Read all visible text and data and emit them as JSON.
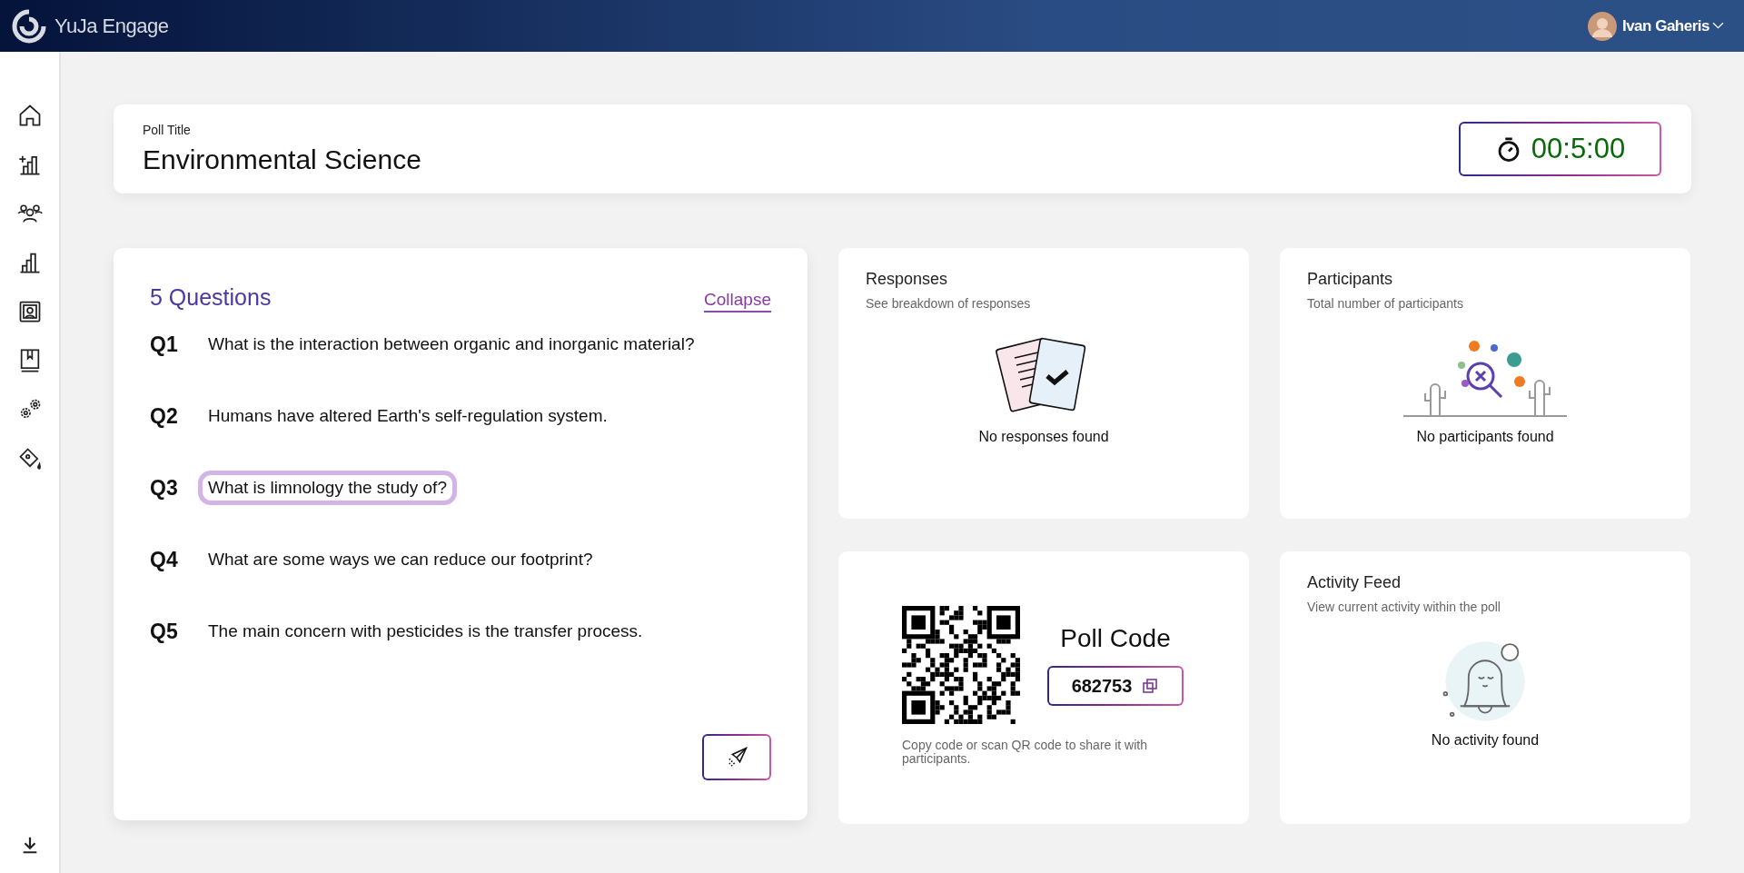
{
  "header": {
    "logo_text": "YuJa Engage",
    "user_name": "Ivan Gaheris"
  },
  "poll": {
    "title_label": "Poll Title",
    "title": "Environmental Science",
    "timer": "00:5:00"
  },
  "questions": {
    "heading": "5 Questions",
    "collapse": "Collapse",
    "items": [
      {
        "number": "Q1",
        "text": "What is the interaction between organic and inorganic material?",
        "selected": false
      },
      {
        "number": "Q2",
        "text": "Humans have altered Earth's self-regulation system.",
        "selected": false
      },
      {
        "number": "Q3",
        "text": "What is limnology the study of?",
        "selected": true
      },
      {
        "number": "Q4",
        "text": "What are some ways we can reduce our footprint?",
        "selected": false
      },
      {
        "number": "Q5",
        "text": "The main concern with pesticides is the transfer process.",
        "selected": false
      }
    ]
  },
  "responses": {
    "title": "Responses",
    "subtitle": "See breakdown of responses",
    "empty": "No responses found"
  },
  "participants": {
    "title": "Participants",
    "subtitle": "Total number of participants",
    "empty": "No participants found"
  },
  "poll_code": {
    "heading": "Poll Code",
    "code": "682753",
    "hint": "Copy code or scan QR code to share it with participants."
  },
  "activity": {
    "title": "Activity Feed",
    "subtitle": "View current activity within the poll",
    "empty": "No activity found"
  }
}
